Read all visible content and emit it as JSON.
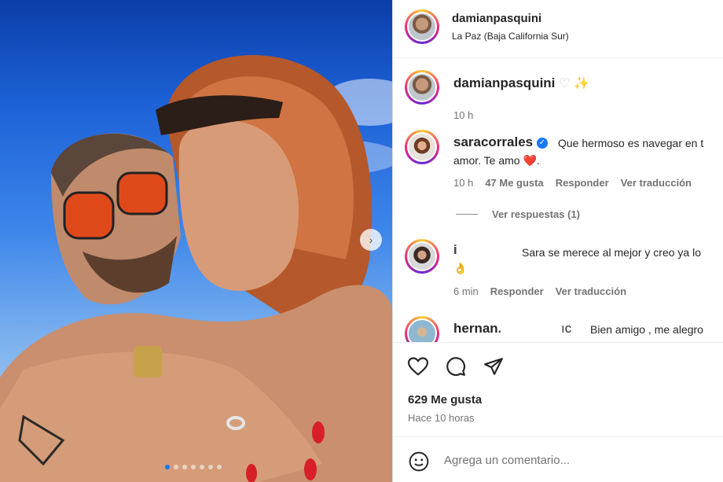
{
  "post": {
    "author": "damianpasquini",
    "location": "La Paz (Baja California Sur)"
  },
  "comments": [
    {
      "user": "damianpasquini",
      "text": "♡ ✨",
      "time": "10 h"
    },
    {
      "user": "saracorrales",
      "verified": true,
      "text_line1": "Que hermoso es navegar en t",
      "text_line2_a": "amor. Te amo",
      "text_line2_heart": "❤️",
      "text_line2_b": ".",
      "time": "10 h",
      "likes": "47 Me gusta",
      "reply": "Responder",
      "translate": "Ver traducción",
      "view_replies": "Ver respuestas (1)"
    },
    {
      "user": "i",
      "text_line1": "Sara se merece al mejor y creo ya lo",
      "text_line2": "👌",
      "time": "6 min",
      "reply": "Responder",
      "translate": "Ver traducción"
    },
    {
      "user": "hernan.",
      "user_suffix": "ıc",
      "text_line1": "Bien amigo , me alegro"
    }
  ],
  "actions": {
    "like_icon": "heart-outline-icon",
    "comment_icon": "comment-bubble-icon",
    "share_icon": "paper-plane-icon"
  },
  "stats": {
    "likes": "629 Me gusta",
    "time": "Hace 10 horas"
  },
  "add_comment": {
    "placeholder": "Agrega un comentario..."
  },
  "carousel": {
    "count": 7,
    "active_index": 0
  },
  "colors": {
    "verified": "#1877f2",
    "meta_text": "#737373",
    "heart": "#e0245e"
  }
}
